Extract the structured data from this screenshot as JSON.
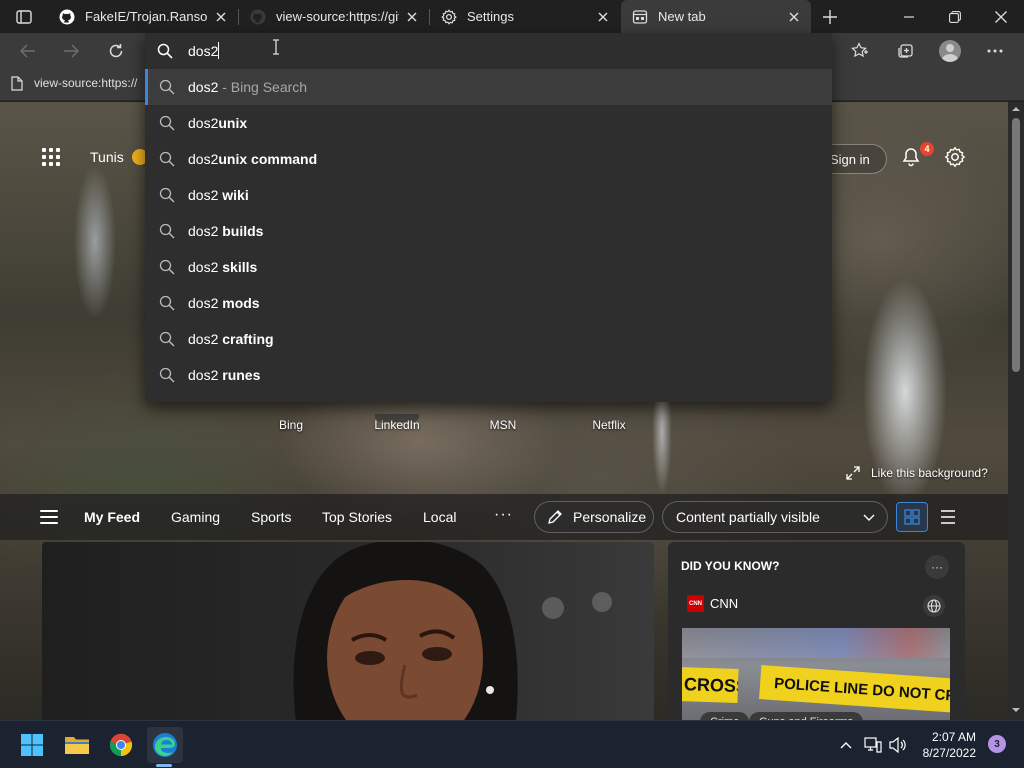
{
  "browser": {
    "tabs": [
      {
        "title": "FakeIE/Trojan.Ransom.B",
        "icon": "github-icon",
        "active": false
      },
      {
        "title": "view-source:https://gith",
        "icon": "github-icon",
        "active": false
      },
      {
        "title": "Settings",
        "icon": "gear-icon",
        "active": false
      },
      {
        "title": "New tab",
        "icon": "new-tab-page-icon",
        "active": true
      }
    ]
  },
  "address_bar": {
    "value": "dos2",
    "suggestions": [
      {
        "prefix": "dos2",
        "bold": "",
        "hint": " - Bing Search",
        "selected": true
      },
      {
        "prefix": "dos2",
        "bold": "unix",
        "hint": "",
        "selected": false
      },
      {
        "prefix": "dos2",
        "bold": "unix command",
        "hint": "",
        "selected": false
      },
      {
        "prefix": "dos2 ",
        "bold": "wiki",
        "hint": "",
        "selected": false
      },
      {
        "prefix": "dos2 ",
        "bold": "builds",
        "hint": "",
        "selected": false
      },
      {
        "prefix": "dos2 ",
        "bold": "skills",
        "hint": "",
        "selected": false
      },
      {
        "prefix": "dos2 ",
        "bold": "mods",
        "hint": "",
        "selected": false
      },
      {
        "prefix": "dos2 ",
        "bold": "crafting",
        "hint": "",
        "selected": false
      },
      {
        "prefix": "dos2 ",
        "bold": "runes",
        "hint": "",
        "selected": false
      }
    ]
  },
  "favorites_bar": {
    "items": [
      {
        "label": "view-source:https://"
      }
    ]
  },
  "new_tab": {
    "weather_city": "Tunis",
    "sign_in_label": "Sign in",
    "notification_count": "4",
    "quick_links": [
      "Bing",
      "LinkedIn",
      "MSN",
      "Netflix"
    ],
    "like_background_label": "Like this background?",
    "feed_tabs": [
      "My Feed",
      "Gaming",
      "Sports",
      "Top Stories",
      "Local"
    ],
    "feed_more": "···",
    "personalize_label": "Personalize",
    "content_visibility": "Content partially visible",
    "did_you_know": {
      "title": "DID YOU KNOW?",
      "more": "···",
      "source": "CNN",
      "source_logo": "CNN",
      "image_text": [
        "CROSS",
        "POLICE LINE DO NOT CROSS"
      ],
      "tags": [
        "Crime",
        "Guns and Firearms"
      ]
    }
  },
  "taskbar": {
    "apps": [
      "windows-start",
      "file-explorer",
      "google-chrome",
      "microsoft-edge"
    ],
    "clock_time": "2:07 AM",
    "clock_date": "8/27/2022",
    "notification_count": "3"
  },
  "colors": {
    "accent": "#3a86d8",
    "notification_badge": "#e3462e",
    "taskbar": "#1c2330"
  }
}
